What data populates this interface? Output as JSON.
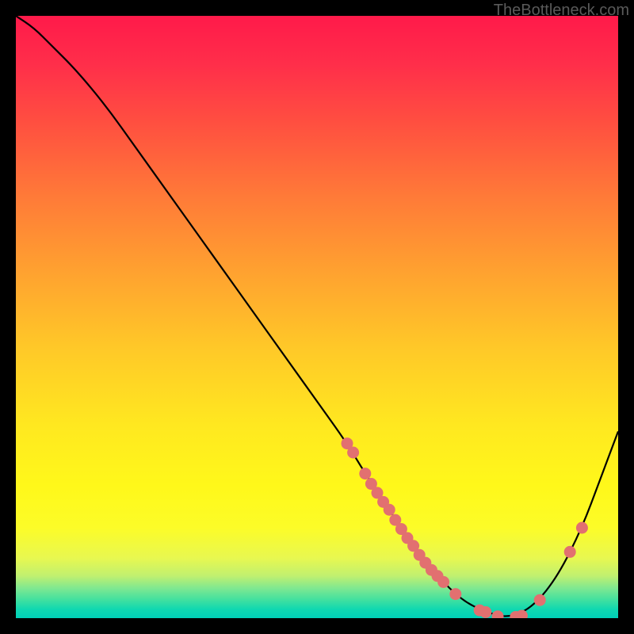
{
  "watermark": "TheBottleneck.com",
  "colors": {
    "curve_stroke": "#000000",
    "dot_fill": "#e27070",
    "background_black": "#000000"
  },
  "chart_data": {
    "type": "line",
    "title": "",
    "xlabel": "",
    "ylabel": "",
    "xlim": [
      0,
      100
    ],
    "ylim": [
      0,
      100
    ],
    "series": [
      {
        "name": "bottleneck-curve",
        "x": [
          0,
          3,
          6,
          10,
          15,
          20,
          25,
          30,
          35,
          40,
          45,
          50,
          55,
          58,
          62,
          66,
          70,
          74,
          78,
          82,
          86,
          90,
          94,
          97,
          100
        ],
        "y": [
          100,
          98,
          95,
          91,
          85,
          78,
          71,
          64,
          57,
          50,
          43,
          36,
          29,
          24,
          18,
          12,
          7,
          3,
          1,
          0,
          2,
          7,
          15,
          23,
          31
        ]
      }
    ],
    "dots": [
      {
        "x": 55,
        "y": 29
      },
      {
        "x": 56,
        "y": 27.5
      },
      {
        "x": 58,
        "y": 24
      },
      {
        "x": 59,
        "y": 22.3
      },
      {
        "x": 60,
        "y": 20.8
      },
      {
        "x": 61,
        "y": 19.3
      },
      {
        "x": 62,
        "y": 18
      },
      {
        "x": 63,
        "y": 16.3
      },
      {
        "x": 64,
        "y": 14.8
      },
      {
        "x": 65,
        "y": 13.3
      },
      {
        "x": 66,
        "y": 12
      },
      {
        "x": 67,
        "y": 10.5
      },
      {
        "x": 68,
        "y": 9.2
      },
      {
        "x": 69,
        "y": 8
      },
      {
        "x": 70,
        "y": 7
      },
      {
        "x": 71,
        "y": 6
      },
      {
        "x": 73,
        "y": 4
      },
      {
        "x": 77,
        "y": 1.3
      },
      {
        "x": 78,
        "y": 1
      },
      {
        "x": 80,
        "y": 0.3
      },
      {
        "x": 83,
        "y": 0.2
      },
      {
        "x": 84,
        "y": 0.4
      },
      {
        "x": 87,
        "y": 3
      },
      {
        "x": 92,
        "y": 11
      },
      {
        "x": 94,
        "y": 15
      }
    ]
  }
}
